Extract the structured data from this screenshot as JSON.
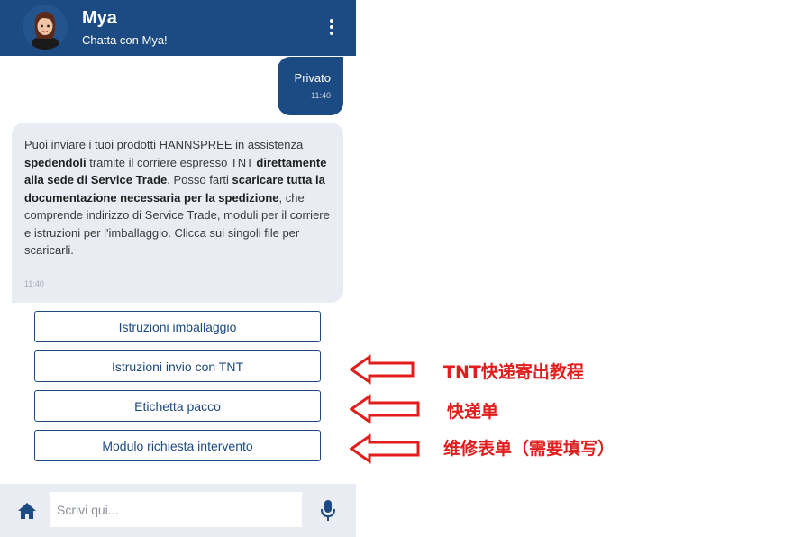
{
  "header": {
    "title": "Mya",
    "subtitle": "Chatta con Mya!"
  },
  "messages": [
    {
      "from": "user",
      "text": "Privato",
      "time": "11:40"
    },
    {
      "from": "bot",
      "parts": [
        "Puoi inviare i tuoi prodotti HANNSPREE in assistenza ",
        "spedendoli",
        " tramite il corriere espresso TNT ",
        "direttamente alla sede di Service Trade",
        ". Posso farti ",
        "scaricare tutta la documentazione necessaria per la spedizione",
        ", che comprende indirizzo di Service Trade, moduli per il corriere e istruzioni per l'imballaggio. Clicca sui singoli file per scaricarli."
      ],
      "time": "11:40"
    }
  ],
  "options": [
    "Istruzioni imballaggio",
    "Istruzioni invio con TNT",
    "Etichetta pacco",
    "Modulo richiesta intervento"
  ],
  "composer": {
    "placeholder": "Scrivi qui..."
  },
  "annotations": [
    "TNT快递寄出教程",
    "快递单",
    "维修表单（需要填写）"
  ],
  "colors": {
    "brand": "#1c4a82",
    "bubble_bot": "#e9ecf3",
    "annotation": "#e11d1d"
  },
  "icons": [
    "avatar",
    "more-vertical-icon",
    "home-icon",
    "microphone-icon",
    "arrow-left-icon"
  ]
}
